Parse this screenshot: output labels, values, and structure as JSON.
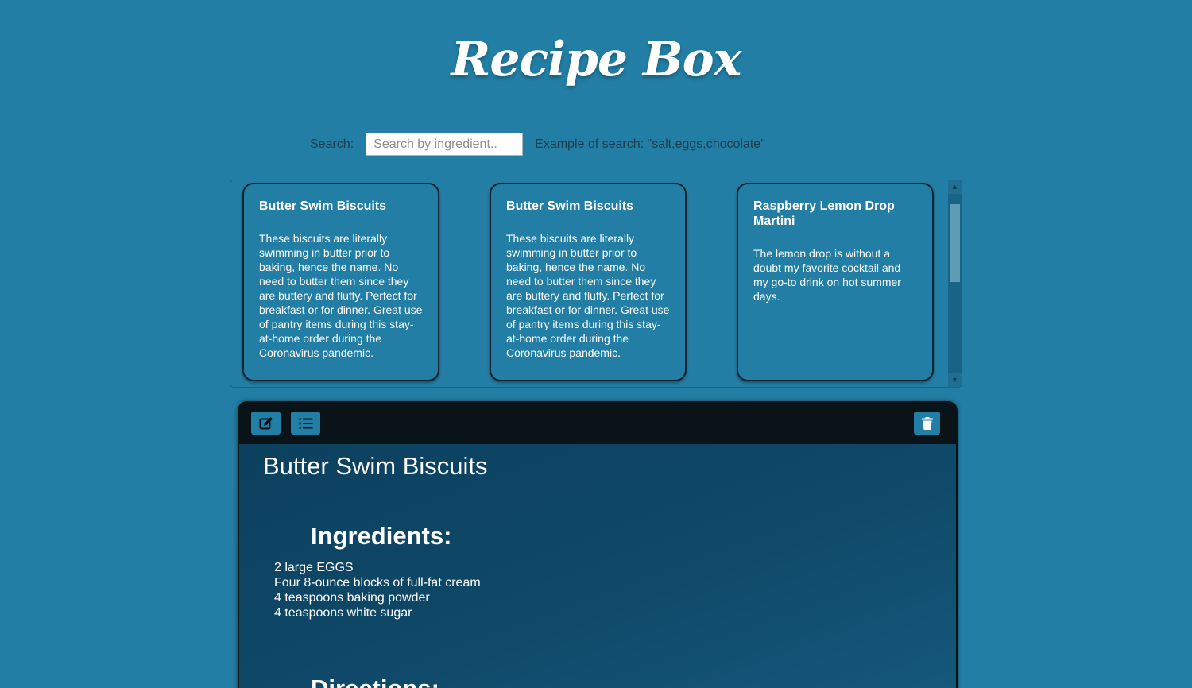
{
  "header": {
    "title": "Recipe Box"
  },
  "search": {
    "label": "Search:",
    "placeholder": "Search by ingredient..",
    "value": "",
    "example": "Example of search: \"salt,eggs,chocolate\""
  },
  "recipes": [
    {
      "title": "Butter Swim Biscuits",
      "description": "These biscuits are literally swimming in butter prior to baking, hence the name. No need to butter them since they are buttery and fluffy. Perfect for breakfast or for dinner. Great use of pantry items during this stay-at-home order during the Coronavirus pandemic."
    },
    {
      "title": "Butter Swim Biscuits",
      "description": "These biscuits are literally swimming in butter prior to baking, hence the name. No need to butter them since they are buttery and fluffy. Perfect for breakfast or for dinner. Great use of pantry items during this stay-at-home order during the Coronavirus pandemic."
    },
    {
      "title": "Raspberry Lemon Drop Martini",
      "description": "The lemon drop is without a doubt my favorite cocktail and my go-to drink on hot summer days."
    }
  ],
  "detail": {
    "toolbar": {
      "edit_icon": "edit-icon",
      "list_icon": "numbered-list-icon",
      "delete_icon": "trash-icon"
    },
    "title": "Butter Swim Biscuits",
    "ingredients_heading": "Ingredients:",
    "ingredients": [
      "2 large EGGS",
      "Four 8-ounce blocks of full-fat cream",
      "4 teaspoons baking powder",
      "4 teaspoons white sugar"
    ],
    "directions_heading": "Directions:"
  },
  "colors": {
    "background": "#227ea4",
    "card_border": "#0b2230",
    "toolbar": "#0a1418",
    "button": "#227ea4"
  }
}
